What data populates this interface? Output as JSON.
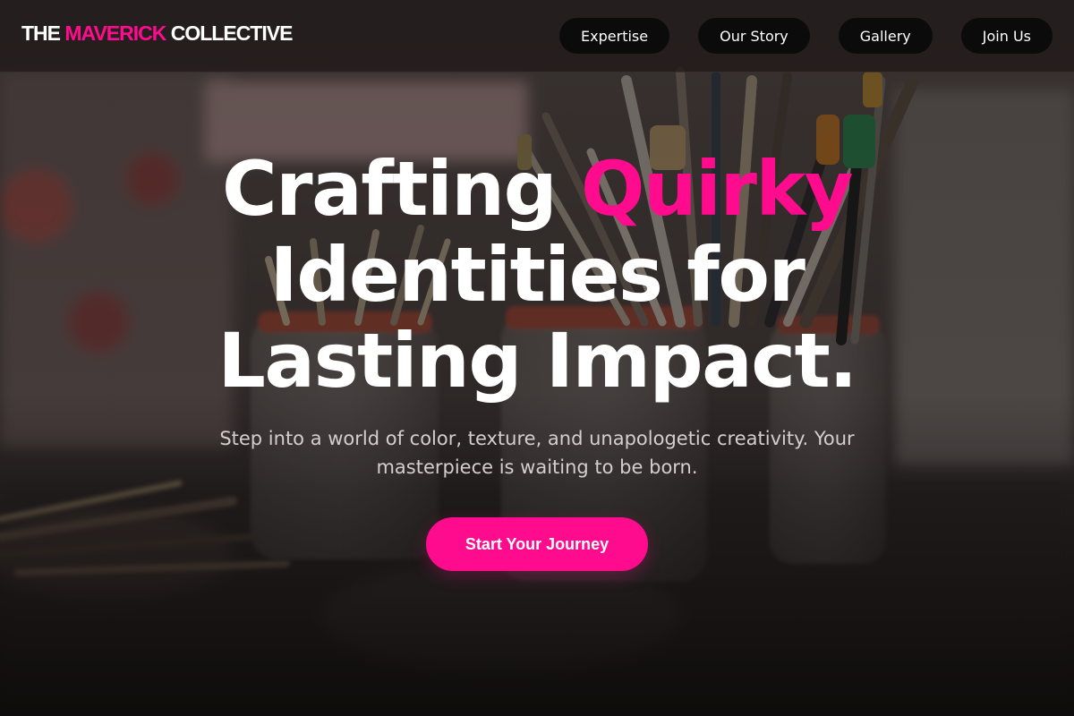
{
  "brand": {
    "part1": "THE ",
    "accent": "MAVERICK",
    "part2": " COLLECTIVE"
  },
  "nav": {
    "links": [
      "Expertise",
      "Our Story",
      "Gallery",
      "Join Us"
    ]
  },
  "hero": {
    "title_part1": "Crafting ",
    "title_highlight": "Quirky",
    "title_line2": "Identities for",
    "title_line3": "Lasting Impact.",
    "subtitle": "Step into a world of color, texture, and unapologetic creativity. Your masterpiece is waiting to be born.",
    "cta_label": "Start Your Journey",
    "background_image": "paint-brushes-in-jars-photo"
  },
  "colors": {
    "accent": "#ff0b8d",
    "nav_bg": "#0b0b0b",
    "text": "#ffffff",
    "subtitle": "#d4cfcd"
  }
}
